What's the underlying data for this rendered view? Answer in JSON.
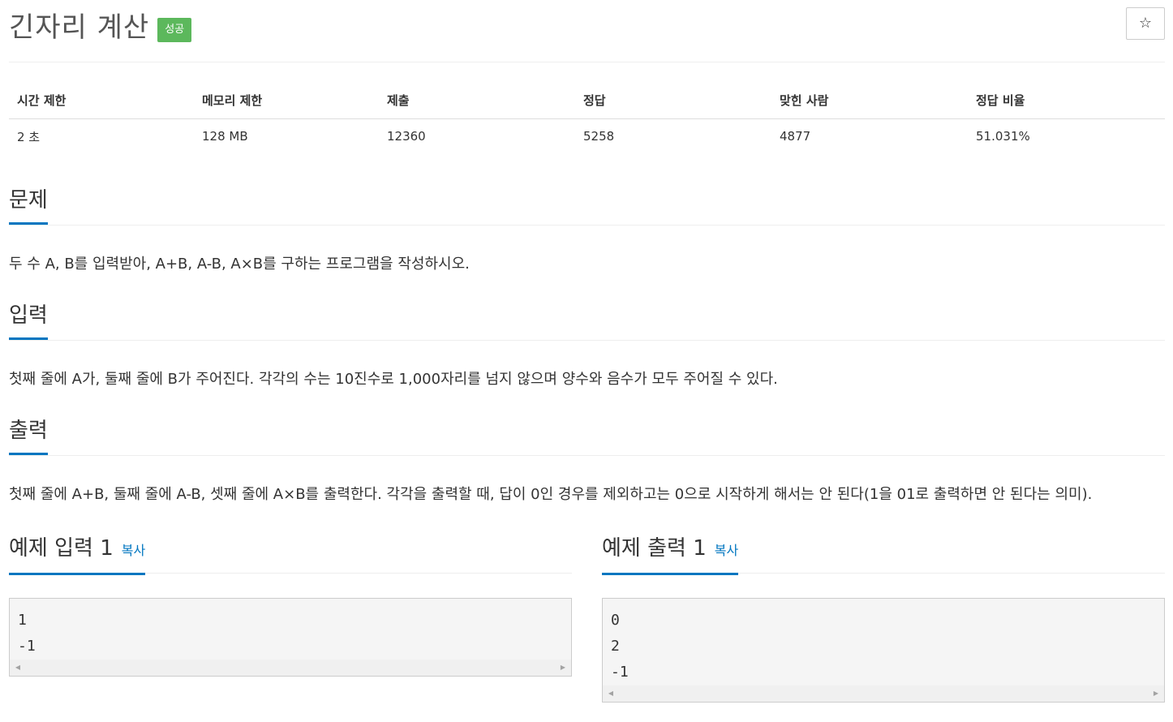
{
  "header": {
    "title": "긴자리 계산",
    "status_badge": "성공",
    "star_icon": "☆"
  },
  "info_table": {
    "headers": [
      "시간 제한",
      "메모리 제한",
      "제출",
      "정답",
      "맞힌 사람",
      "정답 비율"
    ],
    "values": [
      "2 초",
      "128 MB",
      "12360",
      "5258",
      "4877",
      "51.031%"
    ]
  },
  "problem": {
    "title": "문제",
    "text": "두 수 A, B를 입력받아, A+B, A-B, A×B를 구하는 프로그램을 작성하시오."
  },
  "input": {
    "title": "입력",
    "text": "첫째 줄에 A가, 둘째 줄에 B가 주어진다. 각각의 수는 10진수로 1,000자리를 넘지 않으며 양수와 음수가 모두 주어질 수 있다."
  },
  "output": {
    "title": "출력",
    "text": "첫째 줄에 A+B, 둘째 줄에 A-B, 셋째 줄에 A×B를 출력한다. 각각을 출력할 때, 답이 0인 경우를 제외하고는 0으로 시작하게 해서는 안 된다(1을 01로 출력하면 안 된다는 의미)."
  },
  "sample_input": {
    "title": "예제 입력 1",
    "copy_label": "복사",
    "content": "1\n-1"
  },
  "sample_output": {
    "title": "예제 출력 1",
    "copy_label": "복사",
    "content": "0\n2\n-1"
  },
  "scrollbar": {
    "left_arrow": "◀",
    "right_arrow": "▶"
  },
  "colors": {
    "accent": "#0076c0",
    "success": "#5cb85c"
  }
}
